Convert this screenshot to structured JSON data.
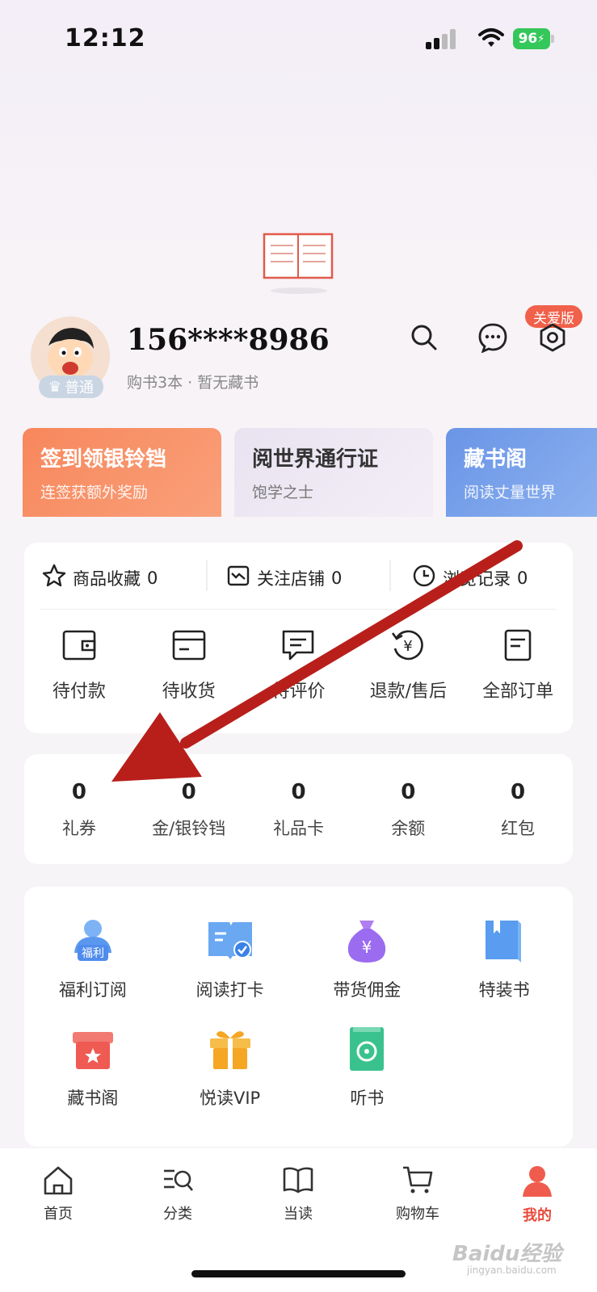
{
  "status_bar": {
    "time": "12:12",
    "battery": "96"
  },
  "profile": {
    "phone": "156****8986",
    "level": "普通",
    "summary": "购书3本 · 暂无藏书",
    "care_tag": "关爱版"
  },
  "promos": [
    {
      "title": "签到领银铃铛",
      "subtitle": "连签获额外奖励",
      "color": "#f7855f"
    },
    {
      "title": "阅世界通行证",
      "subtitle": "饱学之士",
      "color": "#e9e2ef"
    },
    {
      "title": "藏书阁",
      "subtitle": "阅读丈量世界",
      "color": "#6f9ae8"
    }
  ],
  "favorites": [
    {
      "label": "商品收藏",
      "count": "0",
      "icon": "star-icon"
    },
    {
      "label": "关注店铺",
      "count": "0",
      "icon": "shop-icon"
    },
    {
      "label": "浏览记录",
      "count": "0",
      "icon": "clock-icon"
    }
  ],
  "orders": [
    {
      "label": "待付款",
      "icon": "wallet-icon"
    },
    {
      "label": "待收货",
      "icon": "box-icon"
    },
    {
      "label": "待评价",
      "icon": "comment-icon"
    },
    {
      "label": "退款/售后",
      "icon": "refund-icon"
    },
    {
      "label": "全部订单",
      "icon": "orders-icon"
    }
  ],
  "assets": [
    {
      "value": "0",
      "label": "礼券"
    },
    {
      "value": "0",
      "label": "金/银铃铛"
    },
    {
      "value": "0",
      "label": "礼品卡"
    },
    {
      "value": "0",
      "label": "余额"
    },
    {
      "value": "0",
      "label": "红包"
    }
  ],
  "tools": [
    {
      "label": "福利订阅",
      "icon": "welfare-icon",
      "badge": "福利"
    },
    {
      "label": "阅读打卡",
      "icon": "checkin-icon"
    },
    {
      "label": "带货佣金",
      "icon": "money-bag-icon"
    },
    {
      "label": "特装书",
      "icon": "special-book-icon"
    },
    {
      "label": "藏书阁",
      "icon": "gift-star-icon"
    },
    {
      "label": "悦读VIP",
      "icon": "vip-gift-icon"
    },
    {
      "label": "听书",
      "icon": "audiobook-icon"
    }
  ],
  "tabs": [
    {
      "label": "首页",
      "icon": "home-icon",
      "active": false
    },
    {
      "label": "分类",
      "icon": "category-icon",
      "active": false
    },
    {
      "label": "当读",
      "icon": "book-icon",
      "active": false
    },
    {
      "label": "购物车",
      "icon": "cart-icon",
      "active": false
    },
    {
      "label": "我的",
      "icon": "profile-icon",
      "active": true
    }
  ],
  "watermark": {
    "main": "Baidu经验",
    "sub": "jingyan.baidu.com"
  },
  "colors": {
    "accent": "#e94b3c",
    "annotation_arrow": "#b81f1b"
  }
}
